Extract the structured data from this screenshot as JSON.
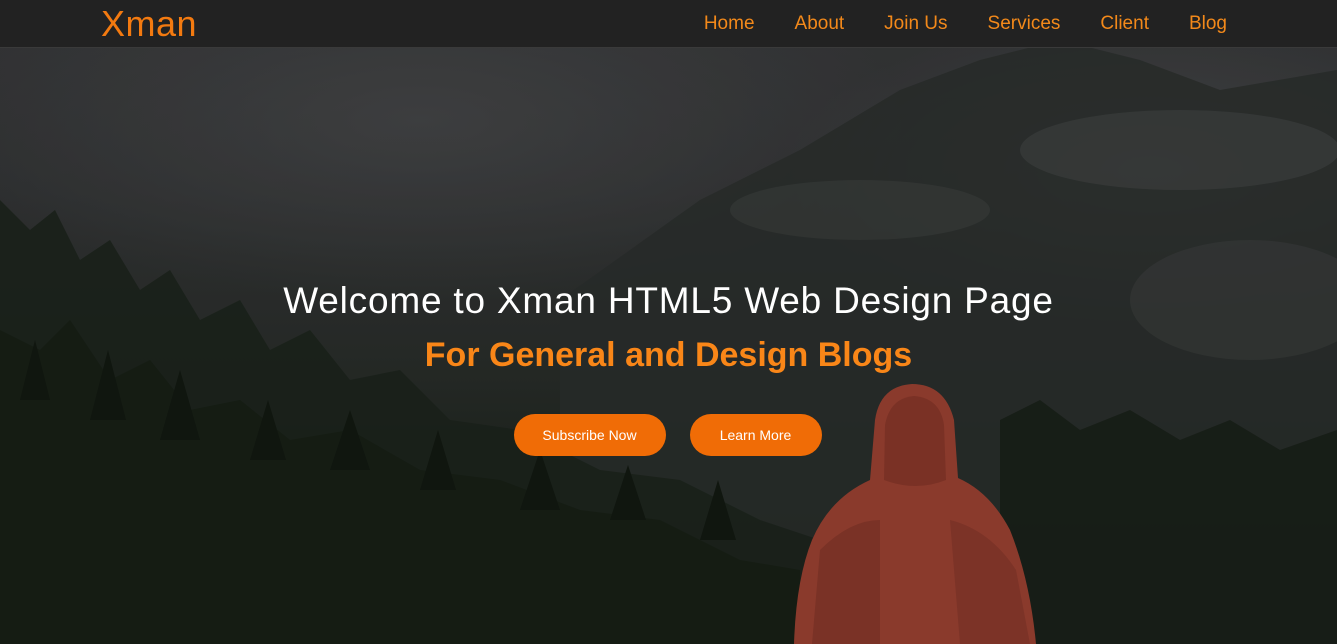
{
  "brand": {
    "name": "Xman"
  },
  "nav": {
    "items": [
      {
        "label": "Home"
      },
      {
        "label": "About"
      },
      {
        "label": "Join Us"
      },
      {
        "label": "Services"
      },
      {
        "label": "Client"
      },
      {
        "label": "Blog"
      }
    ]
  },
  "hero": {
    "title": "Welcome to Xman HTML5 Web Design Page",
    "subtitle": "For General and Design Blogs",
    "buttons": {
      "subscribe_label": "Subscribe Now",
      "learn_label": "Learn More"
    }
  },
  "colors": {
    "accent": "#f37a10",
    "button": "#f06c06",
    "header_bg": "#222222"
  }
}
